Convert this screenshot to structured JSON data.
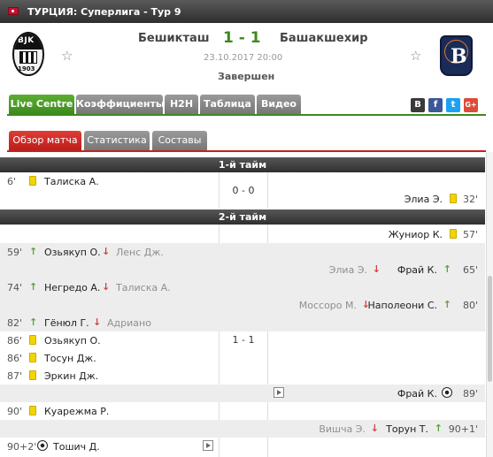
{
  "league": "ТУРЦИЯ: Суперлига - Тур 9",
  "match": {
    "home": "Бешикташ",
    "away": "Башакшехир",
    "score": "1 - 1",
    "datetime": "23.10.2017 20:00",
    "status": "Завершен"
  },
  "home_logo": {
    "text": "BJK",
    "year": "1903"
  },
  "away_logo": {
    "letter": "B"
  },
  "tabs": [
    "Live Centre",
    "Коэффициенты",
    "H2H",
    "Таблица",
    "Видео"
  ],
  "share": [
    {
      "label": "B",
      "color": "#3a3a3a",
      "icon": "vk-icon"
    },
    {
      "label": "f",
      "color": "#3b5998",
      "icon": "facebook-icon"
    },
    {
      "label": "t",
      "color": "#1da1f2",
      "icon": "twitter-icon"
    },
    {
      "label": "G+",
      "color": "#dd4b39",
      "icon": "google-plus-icon"
    }
  ],
  "subtabs": [
    "Обзор матча",
    "Статистика",
    "Составы"
  ],
  "halves": [
    {
      "title": "1-й тайм",
      "score": "0 - 0"
    },
    {
      "title": "2-й тайм",
      "score": "1 - 1"
    }
  ],
  "events": [
    {
      "side": "home",
      "minute": "6'",
      "type": "yellow",
      "player": "Талиска А."
    },
    {
      "side": "away",
      "minute": "32'",
      "type": "yellow",
      "player": "Элиа Э."
    },
    {
      "side": "away",
      "minute": "57'",
      "type": "yellow",
      "player": "Жуниор К."
    },
    {
      "side": "home",
      "minute": "59'",
      "type": "sub",
      "player_in": "Озьякуп О.",
      "player_out": "Ленс Дж."
    },
    {
      "side": "away",
      "minute": "65'",
      "type": "sub",
      "player_in": "Фрай К.",
      "player_out": "Элиа Э."
    },
    {
      "side": "home",
      "minute": "74'",
      "type": "sub",
      "player_in": "Негредо А.",
      "player_out": "Талиска А."
    },
    {
      "side": "away",
      "minute": "80'",
      "type": "sub",
      "player_in": "Наполеони С.",
      "player_out": "Моссоро М."
    },
    {
      "side": "home",
      "minute": "82'",
      "type": "sub",
      "player_in": "Гёнюл Г.",
      "player_out": "Адриано"
    },
    {
      "side": "home",
      "minute": "86'",
      "type": "yellow",
      "player": "Озьякуп О."
    },
    {
      "side": "home",
      "minute": "86'",
      "type": "yellow",
      "player": "Тосун Дж."
    },
    {
      "side": "home",
      "minute": "87'",
      "type": "yellow",
      "player": "Эркин Дж."
    },
    {
      "side": "away",
      "minute": "89'",
      "type": "goal",
      "player": "Фрай К."
    },
    {
      "side": "home",
      "minute": "90'",
      "type": "yellow",
      "player": "Куарежма Р."
    },
    {
      "side": "away",
      "minute": "90+1'",
      "type": "sub",
      "player_in": "Торун Т.",
      "player_out": "Вишча Э."
    },
    {
      "side": "home",
      "minute": "90+2'",
      "type": "goal",
      "player": "Тошич Д."
    }
  ]
}
